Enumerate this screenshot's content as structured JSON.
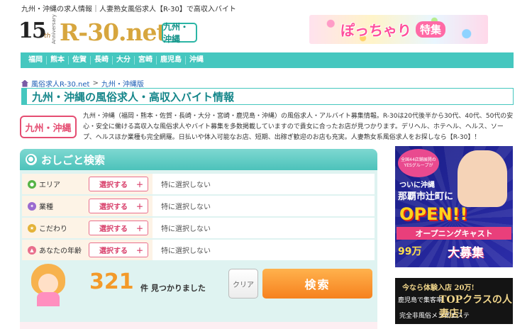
{
  "header": {
    "tagline": "九州・沖縄の求人情報｜人妻熟女風俗求人【R-30】で高収入バイト",
    "logo": {
      "anniv_num": "15",
      "anniv_suffix": "th",
      "anniv_word": "Anniversary",
      "brand": "R-30.net",
      "region": "九州・沖縄"
    },
    "banner": {
      "text1": "ぽっちゃり",
      "text2": "特集"
    }
  },
  "nav": {
    "items": [
      "福岡",
      "熊本",
      "佐賀",
      "長崎",
      "大分",
      "宮崎",
      "鹿児島",
      "沖縄"
    ]
  },
  "breadcrumb": {
    "home": "風俗求人R-30.net",
    "sep": ">",
    "current": "九州・沖縄版"
  },
  "page_title": "九州・沖縄の風俗求人・高収入バイト情報",
  "region_badge": "九州・沖縄",
  "intro_text": "九州・沖縄（福岡・熊本・佐賀・長崎・大分・宮崎・鹿児島・沖縄）の風俗求人・アルバイト募集情報。R-30は20代後半から30代、40代、50代の安心・安全に働ける高収入な風俗求人やバイト募集を多数掲載していますので貴女に合ったお店が見つかります。デリヘル、ホテヘル、ヘルス、ソープ、ヘルスほか業種も完全網羅。日払いや体入可能なお店、短期、出稼ぎ歓迎のお店も充実。人妻熟女系風俗求人をお探しなら【R-30】！",
  "search": {
    "title": "おしごと検索",
    "rows": [
      {
        "label": "エリア",
        "button": "選択する",
        "value": "特に選択しない",
        "icon": "pin-icon",
        "color": "#56b447"
      },
      {
        "label": "業種",
        "button": "選択する",
        "value": "特に選択しない",
        "icon": "ribbon-icon",
        "color": "#9b6bd0"
      },
      {
        "label": "こだわり",
        "button": "選択する",
        "value": "特に選択しない",
        "icon": "star-icon",
        "color": "#e4b33a"
      },
      {
        "label": "あなたの年齢",
        "button": "選択する",
        "value": "特に選択しない",
        "icon": "house-icon",
        "color": "#e96f8d"
      }
    ],
    "button_plus": "＋",
    "result_count": "321",
    "result_suffix": "件 見つかりました",
    "clear_label": "クリア",
    "search_label": "検索"
  },
  "ads": {
    "ad1": {
      "bubble": "全国44店舗展開の YESグループが",
      "line1": "ついに沖縄",
      "line2": "那覇市辻町に",
      "open": "OPEN!!",
      "cast": "オープニングキャスト",
      "pay": "99万",
      "recruit": "大募集"
    },
    "ad2": {
      "line1": "今なら体験入店 20万!",
      "line2": "鹿児島で集客率",
      "line3": "TOPクラスの人妻店!",
      "line4": "完全非風俗メンズエステ"
    }
  },
  "colors": {
    "teal": "#45c7bf",
    "orange": "#f6811e",
    "pink": "#e54d72"
  }
}
